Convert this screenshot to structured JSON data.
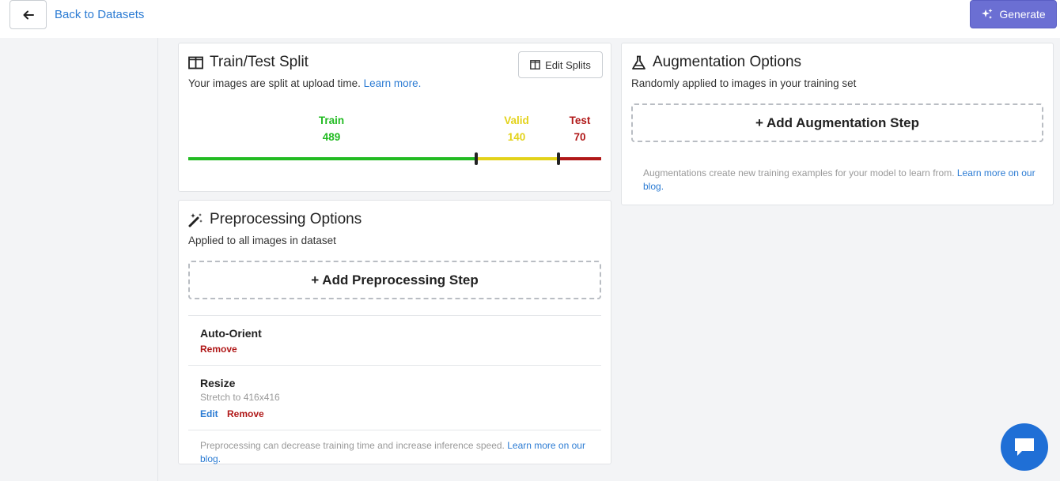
{
  "header": {
    "back_label": "Back to Datasets",
    "generate_label": "Generate",
    "accent": "#6b6fd3"
  },
  "split": {
    "title": "Train/Test Split",
    "subtitle": "Your images are split at upload time.",
    "learn_more": "Learn more.",
    "edit_label": "Edit Splits",
    "train_label": "Train",
    "train_count": "489",
    "valid_label": "Valid",
    "valid_count": "140",
    "test_label": "Test",
    "test_count": "70",
    "colors": {
      "train": "#22bb22",
      "valid": "#e3d21a",
      "test": "#b01818"
    },
    "icon": "split-columns-icon"
  },
  "preprocessing": {
    "title": "Preprocessing Options",
    "subtitle": "Applied to all images in dataset",
    "add_label": "+ Add Preprocessing Step",
    "icon": "magic-wand-icon",
    "steps": [
      {
        "name": "Auto-Orient",
        "description": "",
        "remove": "Remove"
      },
      {
        "name": "Resize",
        "description": "Stretch to 416x416",
        "edit": "Edit",
        "remove": "Remove"
      }
    ],
    "footnote": "Preprocessing can decrease training time and increase inference speed.",
    "footnote_link": "Learn more on our blog."
  },
  "augmentation": {
    "title": "Augmentation Options",
    "subtitle": "Randomly applied to images in your training set",
    "add_label": "+ Add Augmentation Step",
    "icon": "flask-icon",
    "footnote": "Augmentations create new training examples for your model to learn from.",
    "footnote_link": "Learn more on our blog."
  },
  "chat": {
    "icon": "chat-bubble-icon"
  }
}
